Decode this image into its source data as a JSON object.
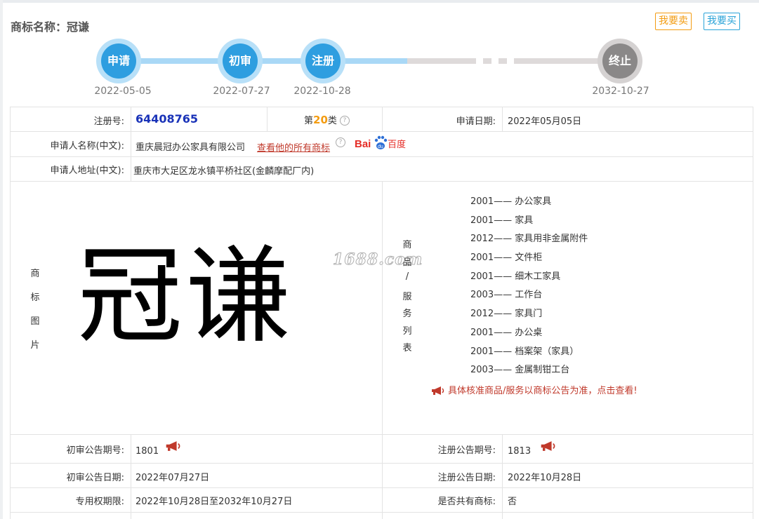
{
  "header": {
    "title": "商标名称：冠谦",
    "sell_label": "我要卖",
    "buy_label": "我要买"
  },
  "timeline": [
    {
      "label": "申请",
      "date": "2022-05-05"
    },
    {
      "label": "初审",
      "date": "2022-07-27"
    },
    {
      "label": "注册",
      "date": "2022-10-28"
    },
    {
      "label": "终止",
      "date": "2032-10-27"
    }
  ],
  "info": {
    "reg_no_label": "注册号:",
    "reg_no": "64408765",
    "class_prefix": "第",
    "class_num": "20",
    "class_suffix": "类",
    "apply_date_label": "申请日期:",
    "apply_date": "2022年05月05日",
    "applicant_label": "申请人名称(中文):",
    "applicant": "重庆晨冠办公家具有限公司",
    "all_marks_link": "查看他的所有商标",
    "address_label": "申请人地址(中文):",
    "address": "重庆市大足区龙水镇平桥社区(金麟摩配厂内)",
    "image_label": [
      "商",
      "标",
      "图",
      "片"
    ],
    "mark_text": "冠谦",
    "watermark": "1688.com",
    "goods_label": [
      "商",
      "品",
      "/",
      "服",
      "务",
      "列",
      "表"
    ],
    "goods": [
      "2001—— 办公家具",
      "2001—— 家具",
      "2012—— 家具用非金属附件",
      "2001—— 文件柜",
      "2001—— 细木工家具",
      "2003—— 工作台",
      "2012—— 家具门",
      "2001—— 办公桌",
      "2001—— 档案架（家具）",
      "2003—— 金属制钳工台"
    ],
    "goods_notice": "具体核准商品/服务以商标公告为准，点击查看!",
    "prelim_no_label": "初审公告期号:",
    "prelim_no": "1801",
    "reg_pub_no_label": "注册公告期号:",
    "reg_pub_no": "1813",
    "prelim_date_label": "初审公告日期:",
    "prelim_date": "2022年07月27日",
    "reg_pub_date_label": "注册公告日期:",
    "reg_pub_date": "2022年10月28日",
    "exclusive_label": "专用权期限:",
    "exclusive": "2022年10月28日至2032年10月27日",
    "shared_label": "是否共有商标:",
    "shared": "否"
  },
  "colors": {
    "accent_blue": "#2e9ee0",
    "reg_no_blue": "#1a33b8",
    "orange": "#f39c12",
    "red": "#c0392b"
  }
}
